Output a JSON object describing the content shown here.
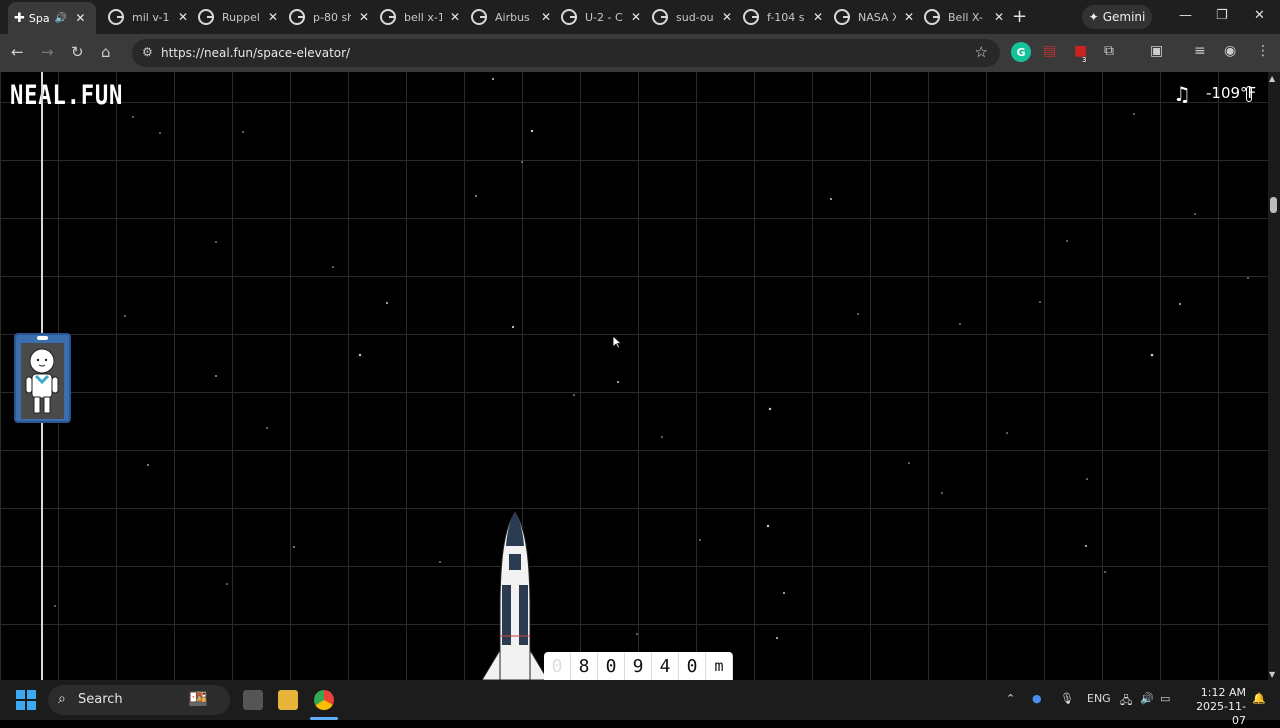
{
  "browser": {
    "tabs": [
      {
        "label": "Spa",
        "active": true
      },
      {
        "label": "mil v-1"
      },
      {
        "label": "Ruppel"
      },
      {
        "label": "p-80 sh"
      },
      {
        "label": "bell x-1"
      },
      {
        "label": "Airbus"
      },
      {
        "label": "U-2 - C"
      },
      {
        "label": "sud-ou"
      },
      {
        "label": "f-104 s"
      },
      {
        "label": "NASA X"
      },
      {
        "label": "Bell X-"
      }
    ],
    "gemini_label": "Gemini",
    "url": "https://neal.fun/space-elevator/",
    "extension_badge": "3"
  },
  "page": {
    "logo": "NEAL.FUN",
    "temperature": "-109°F",
    "altitude_digits": [
      "0",
      "8",
      "0",
      "9",
      "4",
      "0"
    ],
    "altitude_unit": "m"
  },
  "taskbar": {
    "search_label": "Search",
    "language": "ENG",
    "time": "1:12 AM",
    "date": "2025-11-07"
  }
}
